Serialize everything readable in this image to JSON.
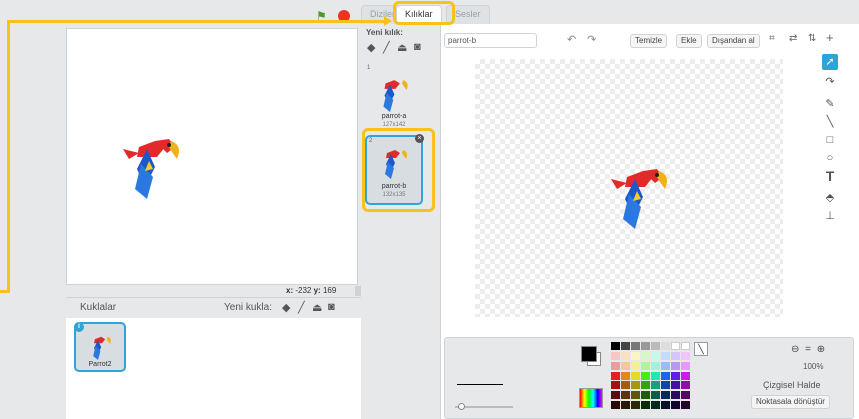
{
  "stage": {
    "coords": {
      "x_label": "x:",
      "x_value": "-232",
      "y_label": "y:",
      "y_value": "169"
    }
  },
  "sprites": {
    "title": "Kuklalar",
    "new_sprite_label": "Yeni kukla:",
    "items": [
      {
        "name": "Parrot2"
      }
    ]
  },
  "tabs": [
    {
      "label": "Diziler"
    },
    {
      "label": "Kılıklar"
    },
    {
      "label": "Sesler"
    }
  ],
  "costumes": {
    "new_label": "Yeni kılık:",
    "items": [
      {
        "num": "1",
        "name": "parrot-a",
        "size": "127x142"
      },
      {
        "num": "2",
        "name": "parrot-b",
        "size": "132x135"
      }
    ]
  },
  "editor": {
    "name_value": "parrot-b",
    "buttons": {
      "clear": "Temizle",
      "add": "Ekle",
      "import": "Dışandan al"
    },
    "zoom": "100%",
    "mode": "Çizgisel Halde",
    "convert": "Noktasala dönüştür"
  },
  "colors": {
    "accent": "#f7c21a",
    "selection": "#2fa4d9"
  }
}
